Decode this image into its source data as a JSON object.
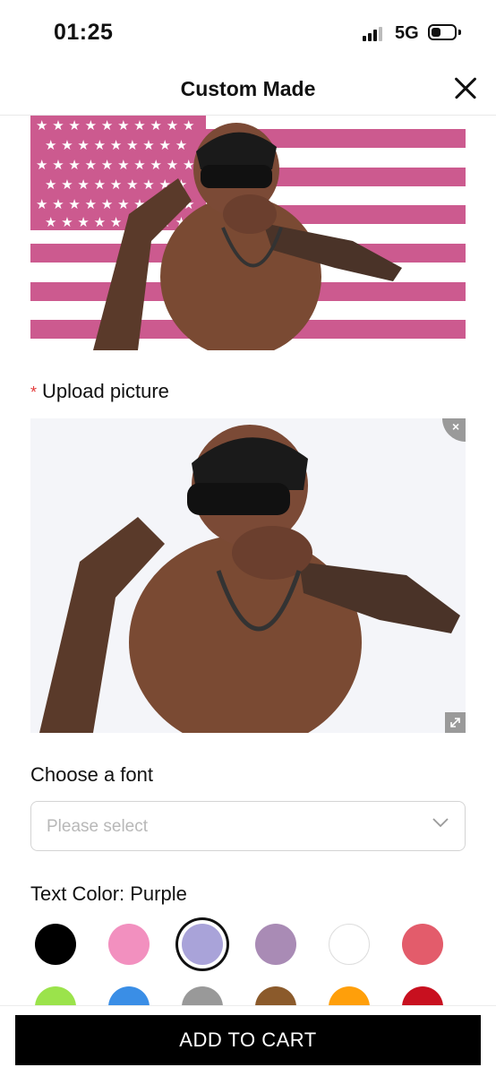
{
  "status_bar": {
    "time": "01:25",
    "network": "5G"
  },
  "header": {
    "title": "Custom Made"
  },
  "upload": {
    "required_mark": "*",
    "label": "Upload picture"
  },
  "font": {
    "label": "Choose a font",
    "placeholder": "Please select"
  },
  "text_color": {
    "label": "Text Color: Purple",
    "selected": "Purple",
    "swatches": [
      {
        "color": "#000000"
      },
      {
        "color": "#f290bf"
      },
      {
        "color": "#a9a3d9",
        "selected": true
      },
      {
        "color": "#a98bb5"
      },
      {
        "color": "#ffffff"
      },
      {
        "color": "#e35c6b"
      },
      {
        "color": "#9be34b"
      },
      {
        "color": "#3a8ee6"
      },
      {
        "color": "#999999"
      },
      {
        "color": "#8b5a2b"
      },
      {
        "color": "#ff9f0a"
      },
      {
        "color": "#c8101f"
      }
    ]
  },
  "cart": {
    "button_label": "ADD TO CART"
  },
  "colors": {
    "flag_stripe": "#cc5a8f",
    "accent": "#000000"
  }
}
